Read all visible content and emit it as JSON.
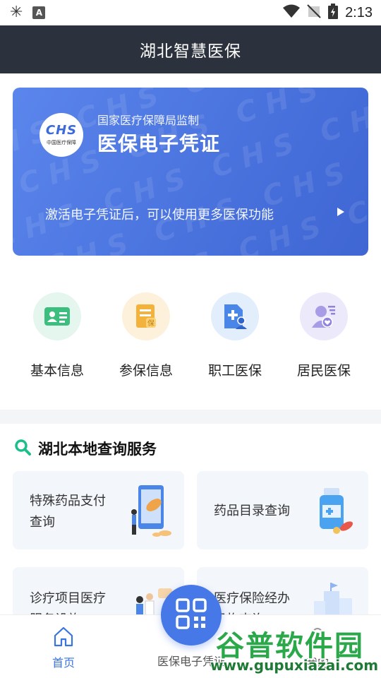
{
  "status_bar": {
    "time": "2:13",
    "icons": [
      "app-bug-icon",
      "a-badge-icon",
      "wifi-icon",
      "no-signal-icon",
      "battery-charging-icon"
    ]
  },
  "header": {
    "title": "湖北智慧医保"
  },
  "voucher_card": {
    "supervisor": "国家医疗保障局监制",
    "title": "医保电子凭证",
    "action_text": "激活电子凭证后，可以使用更多医保功能",
    "logo_text": "CHS",
    "logo_subtext": "中国医疗保障"
  },
  "quick_menu": [
    {
      "label": "基本信息",
      "icon": "id-card-icon",
      "bg": "#e4f6ee",
      "color": "#3cbf7e"
    },
    {
      "label": "参保信息",
      "icon": "insurance-document-icon",
      "bg": "#fdf1dc",
      "color": "#f3b23c"
    },
    {
      "label": "职工医保",
      "icon": "employee-medical-icon",
      "bg": "#e2eefc",
      "color": "#4a86e8"
    },
    {
      "label": "居民医保",
      "icon": "resident-medical-icon",
      "bg": "#ece9fb",
      "color": "#8f83dd"
    }
  ],
  "local_services": {
    "title": "湖北本地查询服务",
    "items": [
      {
        "label_line1": "特殊药品支付",
        "label_line2": "查询",
        "icon": "pills-phone-illustration"
      },
      {
        "label_line1": "药品目录查询",
        "label_line2": "",
        "icon": "medicine-bottle-illustration"
      },
      {
        "label_line1": "诊疗项目医疗",
        "label_line2": "服务设施",
        "icon": "doctors-illustration"
      },
      {
        "label_line1": "医疗保险经办",
        "label_line2": "机构查询",
        "icon": "buildings-illustration"
      }
    ]
  },
  "bottom_nav": {
    "items": [
      {
        "label": "首页",
        "icon": "home-icon",
        "active": true
      },
      {
        "label": "医保电子凭证",
        "icon": "qr-code-icon",
        "active": false
      },
      {
        "label": "我的",
        "icon": "user-icon",
        "active": false
      }
    ],
    "active_color": "#3a74e0"
  },
  "watermark": {
    "top": "谷普软件园",
    "bottom": "www.gupuxiazai.com"
  },
  "colors": {
    "header_bg": "#2c323d",
    "accent": "#4778e8",
    "section_icon": "#1cbf8c"
  }
}
